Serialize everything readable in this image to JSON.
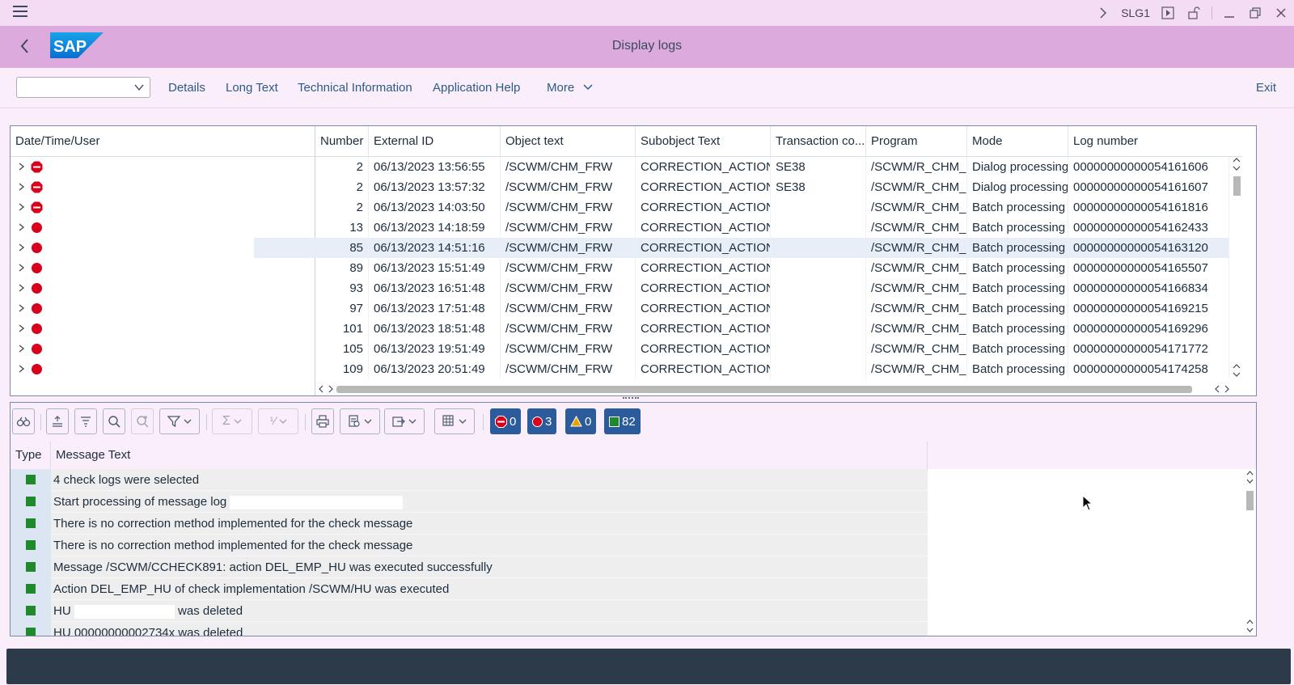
{
  "system_bar": {
    "transaction": "SLG1"
  },
  "title_bar": {
    "title": "Display logs",
    "logo_text": "SAP"
  },
  "toolbar": {
    "combo_value": "",
    "buttons": [
      "Details",
      "Long Text",
      "Technical Information",
      "Application Help",
      "More"
    ],
    "exit_label": "Exit"
  },
  "log_table": {
    "tree_header": "Date/Time/User",
    "columns": [
      "Number",
      "External ID",
      "Object text",
      "Subobject Text",
      "Transaction co...",
      "Program",
      "Mode",
      "Log number"
    ],
    "rows": [
      {
        "status": "stop",
        "number": "2",
        "external_id": "06/13/2023 13:56:55",
        "object": "/SCWM/CHM_FRW",
        "subobject": "CORRECTION_ACTION",
        "tcode": "SE38",
        "program": "/SCWM/R_CHM_LOG",
        "mode": "Dialog processing",
        "log_number": "00000000000054161606"
      },
      {
        "status": "stop",
        "number": "2",
        "external_id": "06/13/2023 13:57:32",
        "object": "/SCWM/CHM_FRW",
        "subobject": "CORRECTION_ACTION",
        "tcode": "SE38",
        "program": "/SCWM/R_CHM_LOG",
        "mode": "Dialog processing",
        "log_number": "00000000000054161607"
      },
      {
        "status": "stop",
        "number": "2",
        "external_id": "06/13/2023 14:03:50",
        "object": "/SCWM/CHM_FRW",
        "subobject": "CORRECTION_ACTION",
        "tcode": "",
        "program": "/SCWM/R_CHM_LOG",
        "mode": "Batch processing",
        "log_number": "00000000000054161816"
      },
      {
        "status": "error",
        "number": "13",
        "external_id": "06/13/2023 14:18:59",
        "object": "/SCWM/CHM_FRW",
        "subobject": "CORRECTION_ACTION",
        "tcode": "",
        "program": "/SCWM/R_CHM_LOG",
        "mode": "Batch processing",
        "log_number": "00000000000054162433"
      },
      {
        "status": "error",
        "number": "85",
        "external_id": "06/13/2023 14:51:16",
        "object": "/SCWM/CHM_FRW",
        "subobject": "CORRECTION_ACTION",
        "tcode": "",
        "program": "/SCWM/R_CHM_LOG",
        "mode": "Batch processing",
        "log_number": "00000000000054163120"
      },
      {
        "status": "error",
        "number": "89",
        "external_id": "06/13/2023 15:51:49",
        "object": "/SCWM/CHM_FRW",
        "subobject": "CORRECTION_ACTION",
        "tcode": "",
        "program": "/SCWM/R_CHM_LOG",
        "mode": "Batch processing",
        "log_number": "00000000000054165507"
      },
      {
        "status": "error",
        "number": "93",
        "external_id": "06/13/2023 16:51:48",
        "object": "/SCWM/CHM_FRW",
        "subobject": "CORRECTION_ACTION",
        "tcode": "",
        "program": "/SCWM/R_CHM_LOG",
        "mode": "Batch processing",
        "log_number": "00000000000054166834"
      },
      {
        "status": "error",
        "number": "97",
        "external_id": "06/13/2023 17:51:48",
        "object": "/SCWM/CHM_FRW",
        "subobject": "CORRECTION_ACTION",
        "tcode": "",
        "program": "/SCWM/R_CHM_LOG",
        "mode": "Batch processing",
        "log_number": "00000000000054169215"
      },
      {
        "status": "error",
        "number": "101",
        "external_id": "06/13/2023 18:51:48",
        "object": "/SCWM/CHM_FRW",
        "subobject": "CORRECTION_ACTION",
        "tcode": "",
        "program": "/SCWM/R_CHM_LOG",
        "mode": "Batch processing",
        "log_number": "00000000000054169296"
      },
      {
        "status": "error",
        "number": "105",
        "external_id": "06/13/2023 19:51:49",
        "object": "/SCWM/CHM_FRW",
        "subobject": "CORRECTION_ACTION",
        "tcode": "",
        "program": "/SCWM/R_CHM_LOG",
        "mode": "Batch processing",
        "log_number": "00000000000054171772"
      },
      {
        "status": "error",
        "number": "109",
        "external_id": "06/13/2023 20:51:49",
        "object": "/SCWM/CHM_FRW",
        "subobject": "CORRECTION_ACTION",
        "tcode": "",
        "program": "/SCWM/R_CHM_LOG",
        "mode": "Batch processing",
        "log_number": "00000000000054174258"
      }
    ]
  },
  "message_panel": {
    "counters": {
      "stop": "0",
      "error": "3",
      "warning": "0",
      "success": "82"
    },
    "columns": [
      "Type",
      "Message Text"
    ],
    "messages": [
      {
        "type": "success",
        "text": "4 check logs were selected"
      },
      {
        "type": "success",
        "text": "Start processing of message log"
      },
      {
        "type": "success",
        "text": "There is no correction method implemented for the check message"
      },
      {
        "type": "success",
        "text": "There is no correction method implemented for the check message"
      },
      {
        "type": "success",
        "text": "Message /SCWM/CCHECK891: action DEL_EMP_HU was executed successfully"
      },
      {
        "type": "success",
        "text": "Action DEL_EMP_HU of check implementation /SCWM/HU was executed"
      },
      {
        "type": "success",
        "text_prefix": "HU",
        "text_suffix": "was deleted"
      },
      {
        "type": "success",
        "text": "HU 00000000002734x was deleted"
      }
    ]
  },
  "colors": {
    "title_bar": "#dcaadc",
    "system_bar": "#f4dcf4",
    "page_bg": "#f9eef9",
    "link": "#2b5b8a",
    "counter_button": "#2b5b9a",
    "error_red": "#d8001b",
    "success_green": "#1f8a2c",
    "footer": "#2c3a4a"
  }
}
